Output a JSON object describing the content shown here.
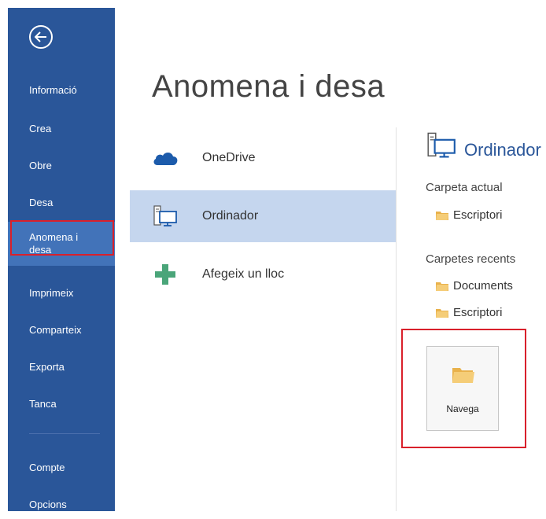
{
  "sidebar": {
    "items": [
      {
        "label": "Informació"
      },
      {
        "label": "Crea"
      },
      {
        "label": "Obre"
      },
      {
        "label": "Desa"
      },
      {
        "label": "Anomena i\ndesa"
      },
      {
        "label": "Imprimeix"
      },
      {
        "label": "Comparteix"
      },
      {
        "label": "Exporta"
      },
      {
        "label": "Tanca"
      },
      {
        "label": "Compte"
      },
      {
        "label": "Opcions"
      }
    ],
    "background": "#2a5699",
    "active_background": "#4273b9"
  },
  "main": {
    "title": "Anomena i desa",
    "places": [
      {
        "label": "OneDrive",
        "icon": "cloud-icon"
      },
      {
        "label": "Ordinador",
        "icon": "computer-icon"
      },
      {
        "label": "Afegeix un lloc",
        "icon": "plus-icon"
      }
    ]
  },
  "right_panel": {
    "heading": "Ordinador",
    "current_folder_label": "Carpeta actual",
    "current_folders": [
      {
        "label": "Escriptori"
      }
    ],
    "recent_folders_label": "Carpetes recents",
    "recent_folders": [
      {
        "label": "Documents"
      },
      {
        "label": "Escriptori"
      }
    ],
    "browse_label": "Navega"
  },
  "colors": {
    "accent": "#2a5699",
    "highlight": "#d9202b",
    "selected_place": "#c5d6ee",
    "folder": "#f2c26b"
  }
}
